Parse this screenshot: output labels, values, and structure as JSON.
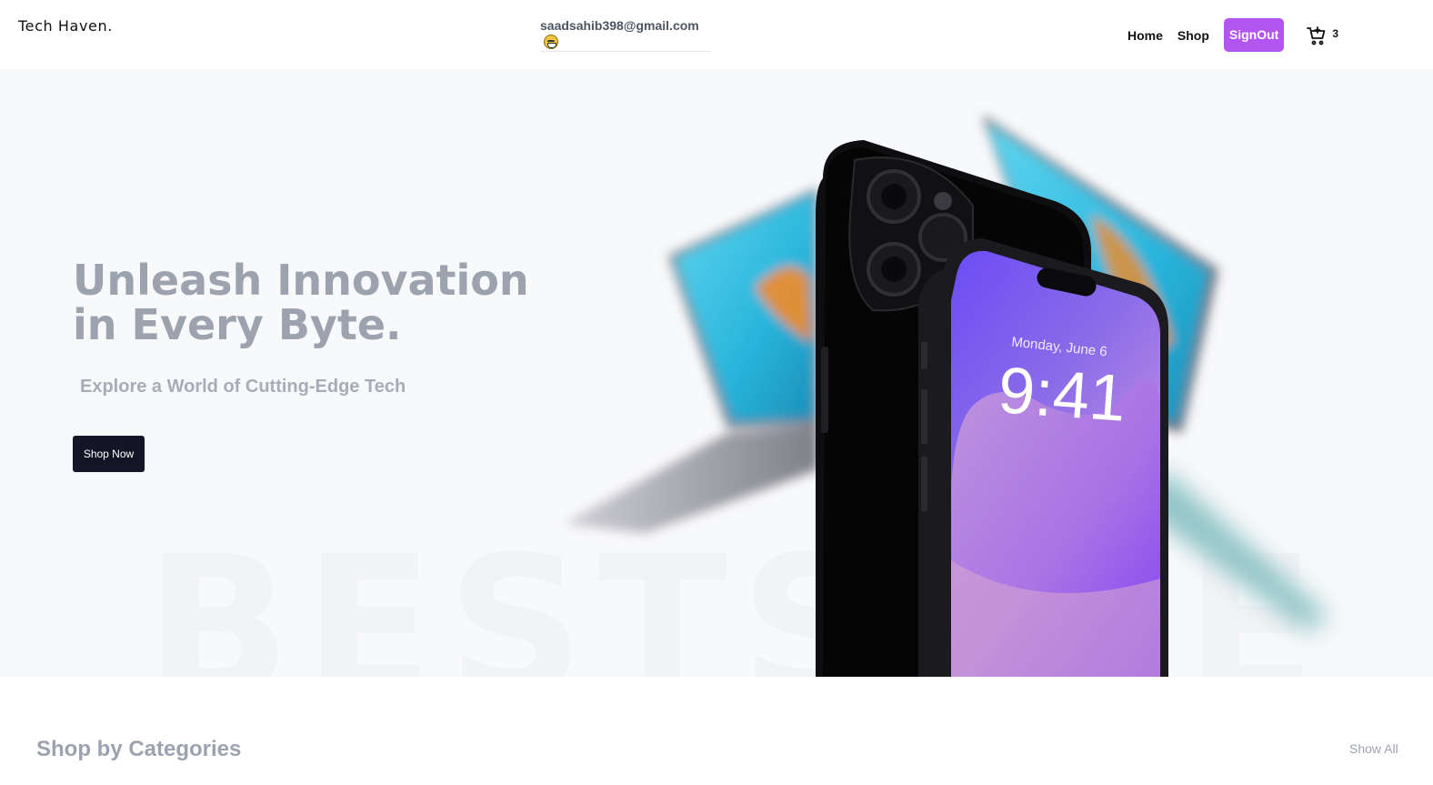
{
  "header": {
    "logo": "Tech Haven.",
    "user_email": "saadsahib398@gmail.com",
    "nav": {
      "home": "Home",
      "shop": "Shop",
      "signout": "SignOut"
    },
    "cart_count": "3"
  },
  "hero": {
    "headline": "Unleash Innovation in Every Byte.",
    "subheadline": "Explore a World of Cutting-Edge Tech",
    "cta": "Shop Now",
    "watermark": "BESTSALE",
    "phone_date": "Monday, June 6",
    "phone_time": "9:41"
  },
  "categories": {
    "title": "Shop by Categories",
    "show_all": "Show All"
  },
  "colors": {
    "signout_bg": "#b355f0",
    "cta_bg": "#151528",
    "hero_bg": "#f8f9fb"
  }
}
